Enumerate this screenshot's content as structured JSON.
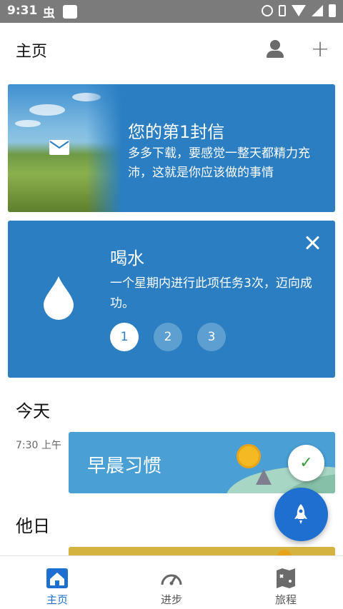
{
  "status_bar": {
    "time": "9:31",
    "left_glyph": "虫",
    "icons": [
      "alarm-icon",
      "vibrate-icon",
      "wifi-icon",
      "signal-icon",
      "battery-icon"
    ]
  },
  "header": {
    "title": "主页",
    "add_label": "+"
  },
  "letter_card": {
    "title": "您的第1封信",
    "body": "多多下载，要感觉一整天都精力充沛，这就是你应该做的事情"
  },
  "water_card": {
    "title": "喝水",
    "body": "一个星期内进行此项任务3次，迈向成功。",
    "steps": [
      "1",
      "2",
      "3"
    ],
    "active_step": 1
  },
  "today": {
    "section_title": "今天",
    "time": "7:30 上午",
    "habit_title": "早晨习惯",
    "check_glyph": "✓"
  },
  "other_days": {
    "section_title": "他日"
  },
  "bottom_nav": {
    "items": [
      {
        "label": "主页",
        "icon": "home-icon",
        "active": true
      },
      {
        "label": "进步",
        "icon": "gauge-icon",
        "active": false
      },
      {
        "label": "旅程",
        "icon": "map-icon",
        "active": false
      }
    ]
  },
  "colors": {
    "card_blue": "#2a7ec1",
    "morning_blue": "#4aa0d5",
    "fab_blue": "#1e6fcf",
    "other_gold": "#d4b341"
  }
}
